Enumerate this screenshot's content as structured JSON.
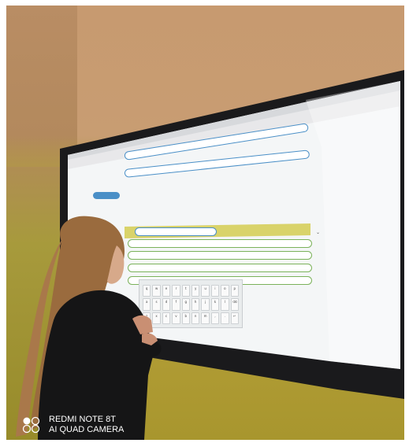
{
  "watermark": {
    "line1": "REDMI NOTE 8T",
    "line2": "AI QUAD CAMERA"
  },
  "screen": {
    "field_1_value": "",
    "field_2_value": "",
    "button_label": "",
    "section_label": "",
    "selected_field_value": "",
    "keyboard_keys": [
      "q",
      "w",
      "e",
      "r",
      "t",
      "y",
      "u",
      "i",
      "o",
      "p",
      "a",
      "s",
      "d",
      "f",
      "g",
      "h",
      "j",
      "k",
      "l",
      "⌫",
      "z",
      "x",
      "c",
      "v",
      "b",
      "n",
      "m",
      ",",
      ".",
      "↵"
    ]
  },
  "colors": {
    "field_border": "#4a8fc7",
    "highlight_row": "#d9d36a",
    "green_border": "#7bb25a"
  }
}
